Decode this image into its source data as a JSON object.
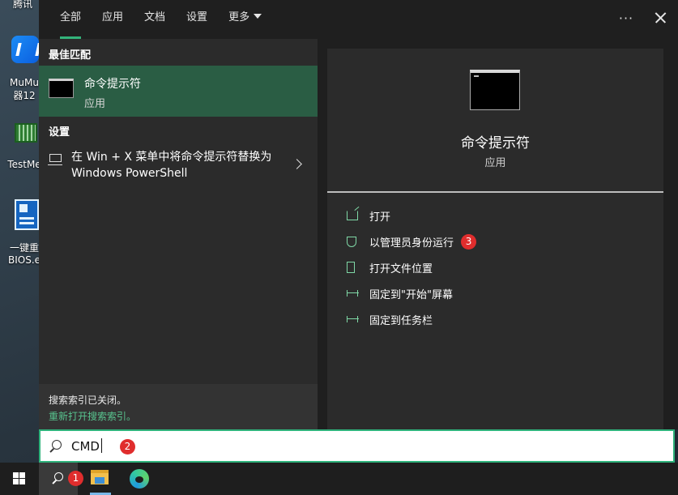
{
  "desktop": {
    "icons": [
      {
        "label": "腾讯",
        "name": "tencent"
      },
      {
        "label": "MuMu",
        "label2": "器12",
        "name": "mumu"
      },
      {
        "label": "TestMe",
        "name": "testme"
      },
      {
        "label": "一键重",
        "label2": "BIOS.e",
        "name": "bios"
      }
    ]
  },
  "tabs": [
    {
      "label": "全部",
      "active": true
    },
    {
      "label": "应用"
    },
    {
      "label": "文档"
    },
    {
      "label": "设置"
    },
    {
      "label": "更多"
    }
  ],
  "toolbar": {
    "more_label": "···"
  },
  "left": {
    "best_match_title": "最佳匹配",
    "best_match": {
      "title": "命令提示符",
      "subtitle": "应用"
    },
    "settings_title": "设置",
    "setting_item": "在 Win + X 菜单中将命令提示符替换为 Windows PowerShell",
    "notice": "搜索索引已关闭。",
    "notice_link": "重新打开搜索索引。"
  },
  "right": {
    "app_title": "命令提示符",
    "app_subtitle": "应用",
    "actions": [
      {
        "label": "打开",
        "icon": "open-icon"
      },
      {
        "label": "以管理员身份运行",
        "icon": "shield-icon",
        "badge": "3"
      },
      {
        "label": "打开文件位置",
        "icon": "file-location-icon"
      },
      {
        "label": "固定到\"开始\"屏幕",
        "icon": "pin-icon"
      },
      {
        "label": "固定到任务栏",
        "icon": "pin-icon"
      }
    ]
  },
  "search": {
    "value": "CMD",
    "badge": "2"
  },
  "taskbar": {
    "search_badge": "1"
  },
  "colors": {
    "accent": "#2fb37c",
    "selected": "#2a5d44",
    "badge": "#e02d2d",
    "link": "#58c48f"
  }
}
